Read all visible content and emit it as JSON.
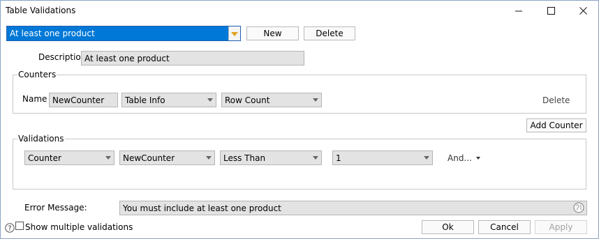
{
  "window": {
    "title": "Table Validations",
    "min_icon": "minimize-icon",
    "max_icon": "maximize-icon",
    "close_icon": "close-icon"
  },
  "top": {
    "selected_validation": "At least one product",
    "new_label": "New",
    "delete_label": "Delete"
  },
  "description": {
    "label": "Description",
    "value": "At least one product"
  },
  "counters": {
    "legend": "Counters",
    "name_label": "Name",
    "name_value": "NewCounter",
    "source": "Table Info",
    "metric": "Row Count",
    "delete_label": "Delete",
    "add_label": "Add Counter"
  },
  "validations": {
    "legend": "Validations",
    "type": "Counter",
    "counter": "NewCounter",
    "operator": "Less Than",
    "value": "1",
    "and_label": "And..."
  },
  "error": {
    "label": "Error Message:",
    "value": "You must include at least one product",
    "icon": "globe-icon"
  },
  "footer": {
    "help_icon": "help-icon",
    "show_multiple_label": "Show multiple validations",
    "ok_label": "Ok",
    "cancel_label": "Cancel",
    "apply_label": "Apply"
  },
  "colors": {
    "selection": "#0078d7",
    "dropdown_arrow": "#e0a21b",
    "field_bg": "#e3e3e3",
    "disabled_text": "#a0a0a0"
  }
}
